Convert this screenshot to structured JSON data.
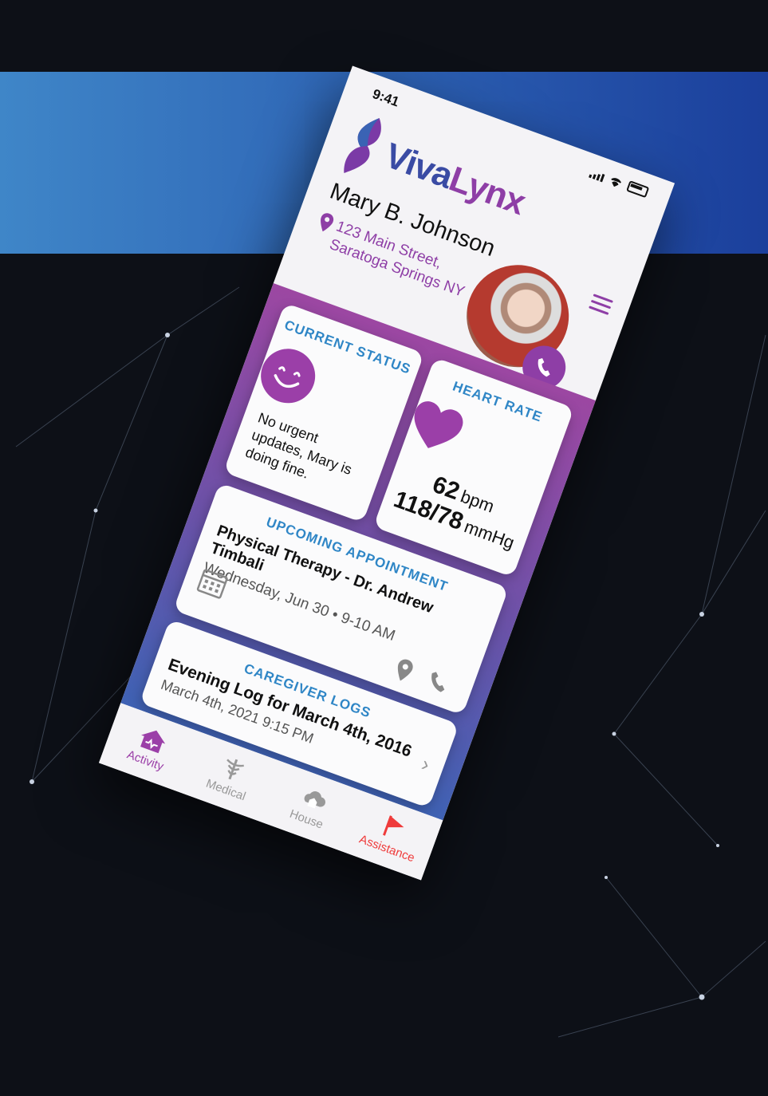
{
  "status_bar": {
    "time": "9:41"
  },
  "brand": {
    "logo_part1": "Viva",
    "logo_part2": "Lynx"
  },
  "profile": {
    "name": "Mary B. Johnson",
    "address_line1": "123 Main Street,",
    "address_line2": "Saratoga Springs NY"
  },
  "cards": {
    "status": {
      "title": "CURRENT STATUS",
      "text": "No urgent updates, Mary is doing fine."
    },
    "heart": {
      "title": "HEART RATE",
      "bpm": "62",
      "bpm_unit": "bpm",
      "bp": "118/78",
      "bp_unit": "mmHg"
    },
    "appointment": {
      "title": "UPCOMING APPOINTMENT",
      "name": "Physical Therapy - Dr. Andrew Timbali",
      "when": "Wednesday, Jun 30 • 9-10 AM"
    },
    "logs": {
      "title": "CAREGIVER LOGS",
      "entry": "Evening Log for March 4th, 2016",
      "time": "March 4th, 2021 9:15 PM"
    }
  },
  "tabs": [
    {
      "label": "Activity",
      "icon": "house-heart-icon"
    },
    {
      "label": "Medical",
      "icon": "caduceus-icon"
    },
    {
      "label": "House",
      "icon": "cloud-house-icon"
    },
    {
      "label": "Assistance",
      "icon": "flag-icon"
    }
  ],
  "colors": {
    "purple": "#8e3ea6",
    "blue_title": "#2f86c6",
    "alert_red": "#ef3b3b"
  }
}
